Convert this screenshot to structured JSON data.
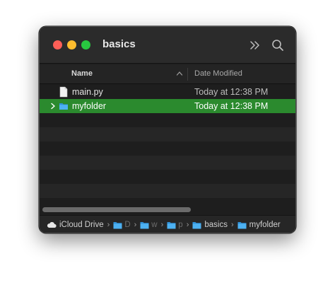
{
  "window": {
    "title": "basics"
  },
  "toolbar": {
    "more_icon": "chevron-double-right-icon",
    "search_icon": "magnifier-icon"
  },
  "columns": {
    "name": "Name",
    "date": "Date Modified"
  },
  "files": [
    {
      "name": "main.py",
      "date": "Today at 12:38 PM",
      "kind": "file",
      "selected": false
    },
    {
      "name": "myfolder",
      "date": "Today at 12:38 PM",
      "kind": "folder",
      "selected": true
    }
  ],
  "path": {
    "root": "iCloud Drive",
    "c1": "D",
    "c2": "w",
    "c3": "p",
    "c4": "basics",
    "c5": "myfolder"
  },
  "colors": {
    "selection": "#2b8a2e",
    "folder": "#3aa0e8",
    "window_bg": "#1e1e1e"
  }
}
